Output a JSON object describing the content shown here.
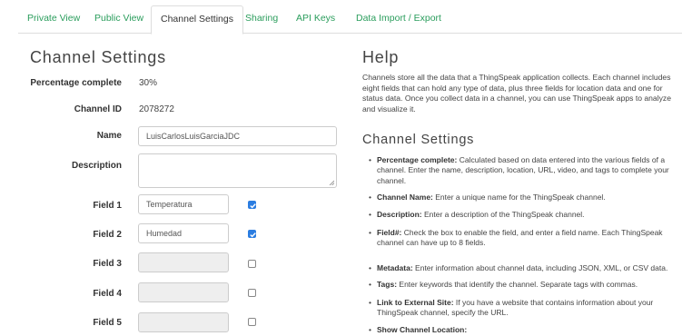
{
  "tabs": [
    {
      "label": "Private View",
      "active": false
    },
    {
      "label": "Public View",
      "active": false
    },
    {
      "label": "Channel Settings",
      "active": true
    },
    {
      "label": "Sharing",
      "active": false
    },
    {
      "label": "API Keys",
      "active": false
    },
    {
      "label": "Data Import / Export",
      "active": false
    }
  ],
  "colors": {
    "link": "#2a9d5c",
    "checkbox_checked": "#2b7de1"
  },
  "settings": {
    "title": "Channel Settings",
    "percentage_label": "Percentage complete",
    "percentage_value": "30%",
    "channel_id_label": "Channel ID",
    "channel_id_value": "2078272",
    "name_label": "Name",
    "name_value": "LuisCarlosLuisGarciaJDC",
    "description_label": "Description",
    "description_value": "",
    "fields": [
      {
        "label": "Field 1",
        "value": "Temperatura",
        "checked": true
      },
      {
        "label": "Field 2",
        "value": "Humedad",
        "checked": true
      },
      {
        "label": "Field 3",
        "value": "",
        "checked": false
      },
      {
        "label": "Field 4",
        "value": "",
        "checked": false
      },
      {
        "label": "Field 5",
        "value": "",
        "checked": false
      }
    ]
  },
  "help": {
    "title": "Help",
    "intro": "Channels store all the data that a ThingSpeak application collects. Each channel includes eight fields that can hold any type of data, plus three fields for location data and one for status data. Once you collect data in a channel, you can use ThingSpeak apps to analyze and visualize it.",
    "subtitle": "Channel Settings",
    "items": [
      {
        "term": "Percentage complete:",
        "text": " Calculated based on data entered into the various fields of a channel. Enter the name, description, location, URL, video, and tags to complete your channel."
      },
      {
        "term": "Channel Name:",
        "text": " Enter a unique name for the ThingSpeak channel."
      },
      {
        "term": "Description:",
        "text": " Enter a description of the ThingSpeak channel."
      },
      {
        "term": "Field#:",
        "text": " Check the box to enable the field, and enter a field name. Each ThingSpeak channel can have up to 8 fields."
      },
      {
        "term": "Metadata:",
        "text": " Enter information about channel data, including JSON, XML, or CSV data."
      },
      {
        "term": "Tags:",
        "text": " Enter keywords that identify the channel. Separate tags with commas."
      },
      {
        "term": "Link to External Site:",
        "text": " If you have a website that contains information about your ThingSpeak channel, specify the URL."
      },
      {
        "term": "Show Channel Location:",
        "text": ""
      }
    ]
  }
}
